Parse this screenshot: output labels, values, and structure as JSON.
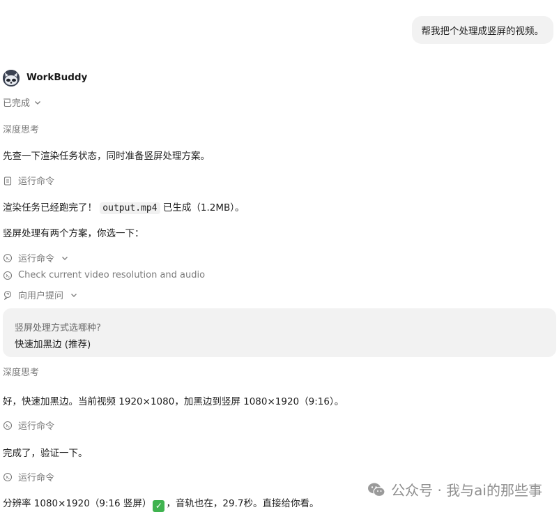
{
  "user_message": "帮我把个处理成竖屏的视频。",
  "bot": {
    "name": "WorkBuddy",
    "status": "已完成",
    "avatar_icon": "raccoon-avatar-icon"
  },
  "thinking_label_1": "深度思考",
  "message_1": "先查一下渲染任务状态，同时准备竖屏处理方案。",
  "tool_1": "运行命令",
  "message_2_prefix": "渲染任务已经跑完了！",
  "message_2_code": "output.mp4",
  "message_2_suffix": "已生成（1.2MB）。",
  "message_3": "竖屏处理有两个方案，你选一下：",
  "tool_2": "运行命令",
  "tool_3": "Check current video resolution and audio",
  "tool_4": "向用户提问",
  "question_card": {
    "question": "竖屏处理方式选哪种?",
    "answer": "快速加黑边 (推荐)"
  },
  "thinking_label_2": "深度思考",
  "message_4": "好，快速加黑边。当前视频 1920×1080，加黑边到竖屏 1080×1920（9:16）。",
  "tool_5": "运行命令",
  "message_5": "完成了，验证一下。",
  "tool_6": "运行命令",
  "message_6_prefix": "分辨率 1080×1920（9:16 竖屏）",
  "message_6_suffix": "，音轨也在，29.7秒。直接给你看。",
  "watermark": "公众号 · 我与ai的那些事",
  "colors": {
    "accent_check": "#3fb34f",
    "bubble_bg": "#f2f2f2",
    "muted_text": "#7a7a7a"
  }
}
